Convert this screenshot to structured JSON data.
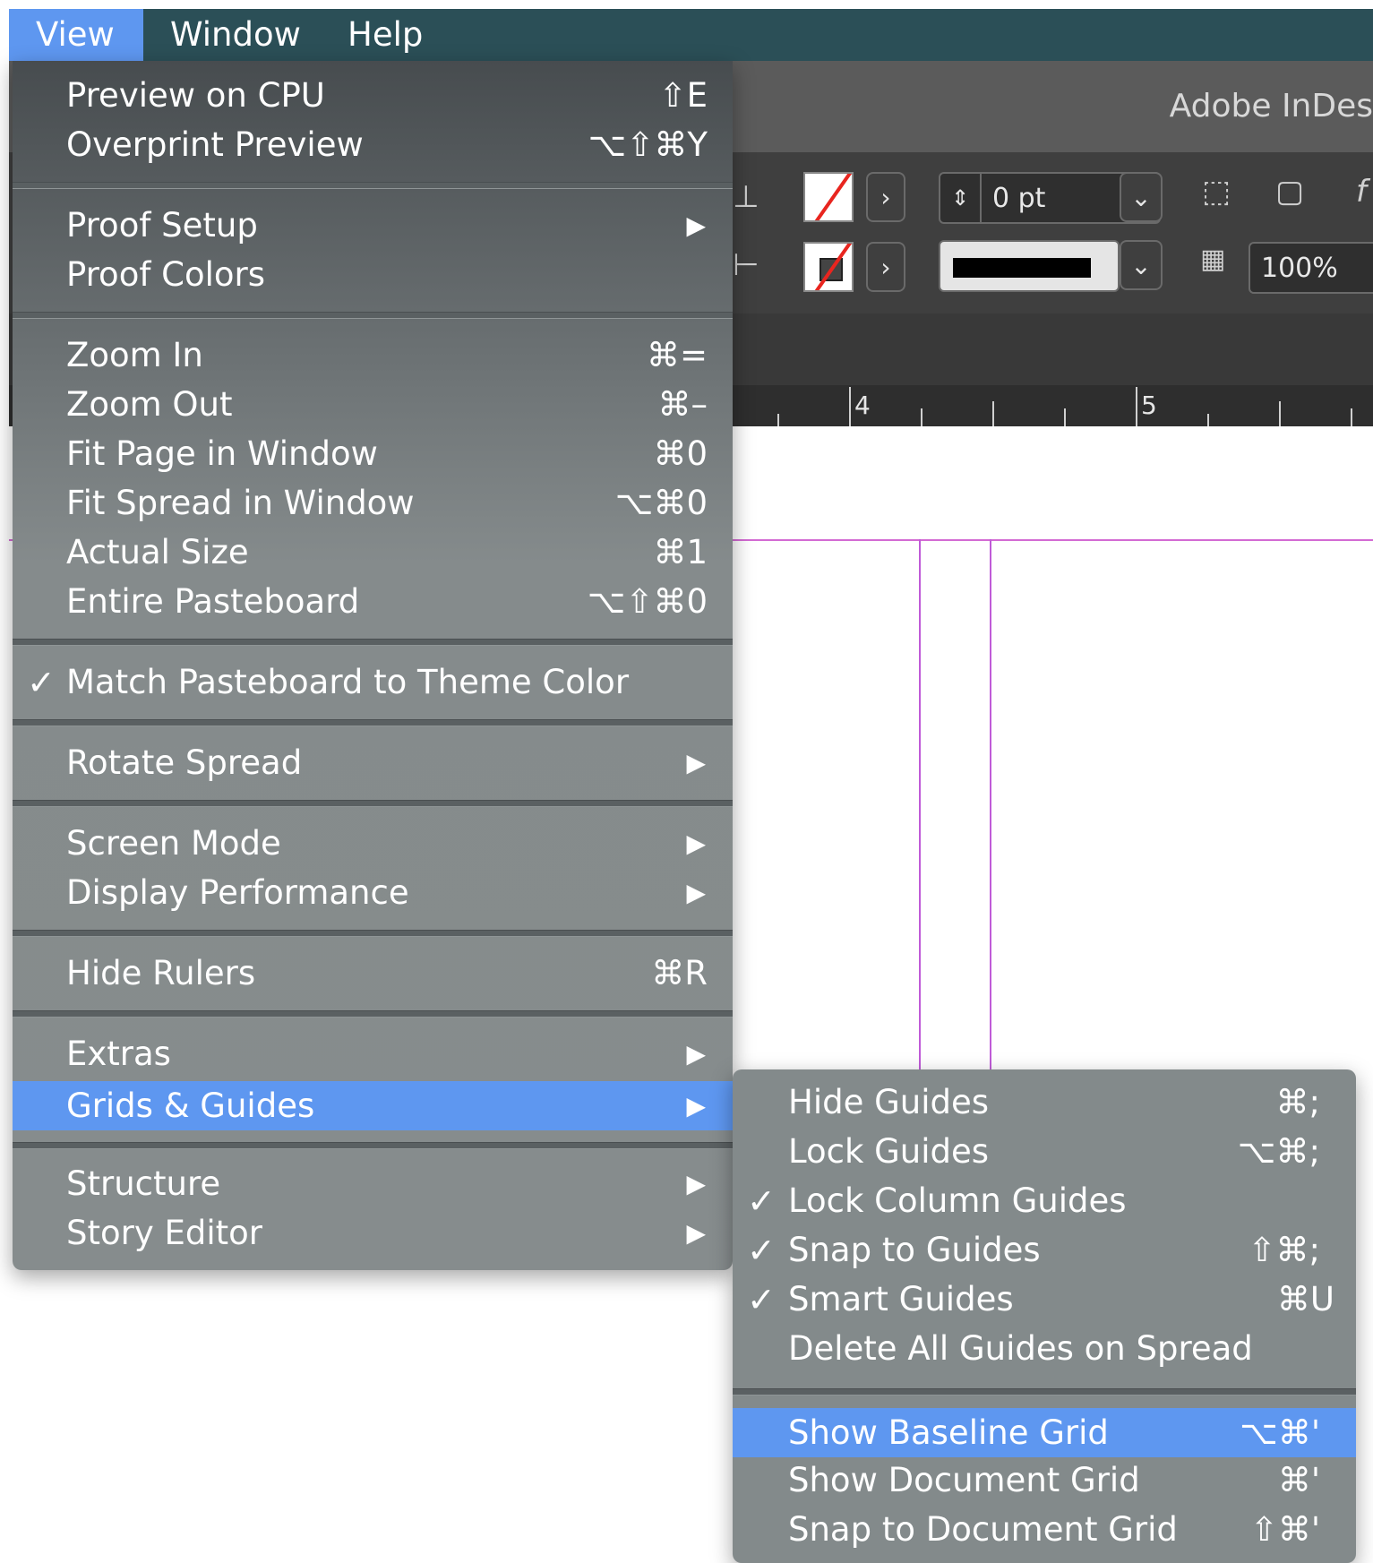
{
  "menubar": {
    "items": [
      "View",
      "Window",
      "Help"
    ]
  },
  "app": {
    "title": "Adobe InDes",
    "stroke_weight": "0 pt",
    "opacity": "100%",
    "ruler_labels": [
      "4",
      "5"
    ]
  },
  "view_menu": {
    "items": [
      {
        "label": "Preview on CPU",
        "shortcut": "⇧E"
      },
      {
        "label": "Overprint Preview",
        "shortcut": "⌥⇧⌘Y"
      },
      {
        "label": "Proof Setup",
        "shortcut": ""
      },
      {
        "label": "Proof Colors",
        "shortcut": ""
      },
      {
        "label": "Zoom In",
        "shortcut": "⌘="
      },
      {
        "label": "Zoom Out",
        "shortcut": "⌘–"
      },
      {
        "label": "Fit Page in Window",
        "shortcut": "⌘0"
      },
      {
        "label": "Fit Spread in Window",
        "shortcut": "⌥⌘0"
      },
      {
        "label": "Actual Size",
        "shortcut": "⌘1"
      },
      {
        "label": "Entire Pasteboard",
        "shortcut": "⌥⇧⌘0"
      },
      {
        "label": "Match Pasteboard to Theme Color",
        "shortcut": ""
      },
      {
        "label": "Rotate Spread",
        "shortcut": ""
      },
      {
        "label": "Screen Mode",
        "shortcut": ""
      },
      {
        "label": "Display Performance",
        "shortcut": ""
      },
      {
        "label": "Hide Rulers",
        "shortcut": "⌘R"
      },
      {
        "label": "Extras",
        "shortcut": ""
      },
      {
        "label": "Grids & Guides",
        "shortcut": ""
      },
      {
        "label": "Structure",
        "shortcut": ""
      },
      {
        "label": "Story Editor",
        "shortcut": ""
      }
    ]
  },
  "submenu": {
    "items": [
      {
        "label": "Hide Guides",
        "shortcut": "⌘;"
      },
      {
        "label": "Lock Guides",
        "shortcut": "⌥⌘;"
      },
      {
        "label": "Lock Column Guides",
        "shortcut": ""
      },
      {
        "label": "Snap to Guides",
        "shortcut": "⇧⌘;"
      },
      {
        "label": "Smart Guides",
        "shortcut": "⌘U"
      },
      {
        "label": "Delete All Guides on Spread",
        "shortcut": ""
      },
      {
        "label": "Show Baseline Grid",
        "shortcut": "⌥⌘'"
      },
      {
        "label": "Show Document Grid",
        "shortcut": "⌘'"
      },
      {
        "label": "Snap to Document Grid",
        "shortcut": "⇧⌘'"
      }
    ]
  },
  "glyphs": {
    "check": "✓",
    "submenu_arrow": "▶",
    "chevron_right": "›",
    "chevron_down": "⌄"
  },
  "colors": {
    "menu_highlight": "#5e97f0",
    "menubar": "#2b4f57",
    "guide": "#c05bd8"
  }
}
